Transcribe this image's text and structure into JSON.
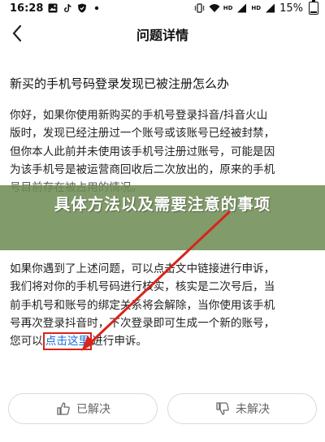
{
  "status_bar": {
    "time": "16:28",
    "left_icons": [
      "image-icon",
      "tiktok-icon",
      "shield-icon",
      "dot-icon"
    ],
    "right_icons": [
      "vibrate-icon",
      "wifi-icon",
      "hd-icon",
      "signal-icon",
      "hd-icon",
      "signal-icon"
    ],
    "hd_label": "HD",
    "battery_percent": "15%",
    "battery_level": 0.15
  },
  "nav": {
    "title": "问题详情",
    "back_icon": "chevron-left-icon"
  },
  "question": {
    "title": "新买的手机号码登录发现已被注册怎么办"
  },
  "answer": {
    "paragraph1_lines": [
      "你好，如果你使用新购买的手机号登录抖音/抖音火山",
      "版时，发现已经注册过一个账号或该账号已经被封禁，",
      "但你本人此前并未使用该手机号注册过账号，可能是因",
      "为该手机号是被运营商回收后二次放出的，原来的手机",
      "号目前存在被占用的情况。"
    ],
    "paragraph2_lines": [
      "如果你遇到了上述问题，可以点击文中链接进行申诉，",
      "我们将对你的手机号码进行核实，核实是二次号后，当",
      "前手机号和账号的绑定关系将会解除，当你使用该手机",
      "号再次登录抖音时，下次登录即可生成一个新的账号，"
    ],
    "last_line_prefix": "您可以",
    "link_text": "点击这里",
    "last_line_suffix": "进行申诉。"
  },
  "banner": {
    "text": "具体方法以及需要注意的事项"
  },
  "feedback": {
    "resolved_label": "已解决",
    "unresolved_label": "未解决",
    "resolved_icon": "thumbs-up-icon",
    "unresolved_icon": "thumbs-down-icon"
  },
  "colors": {
    "banner": "#6c8a52",
    "arrow": "#d8241c",
    "link": "#1a6fd8",
    "highlight_box": "#d8241c"
  }
}
